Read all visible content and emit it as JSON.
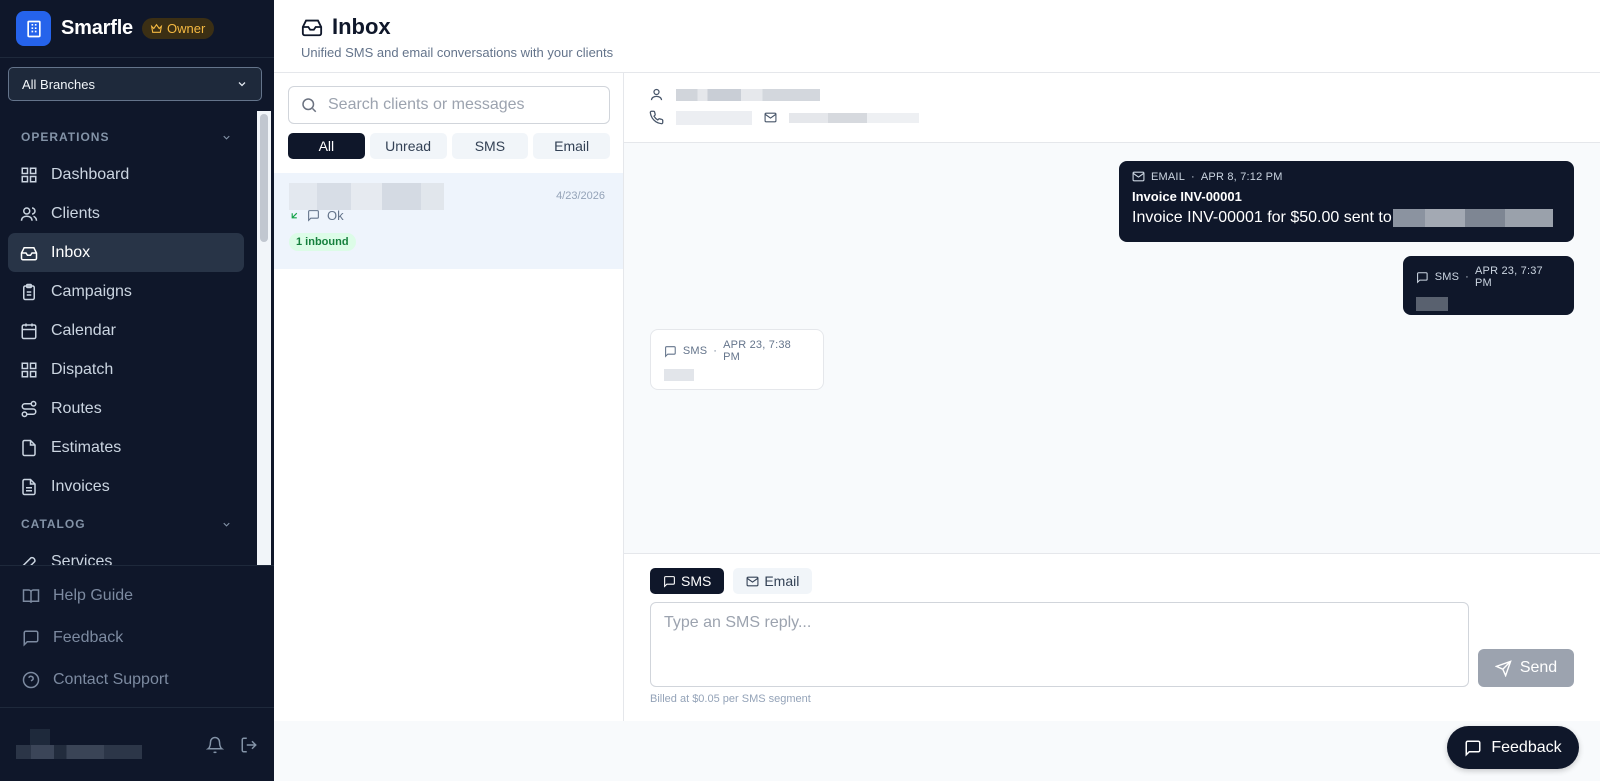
{
  "brand": {
    "name": "Smarfle",
    "role_badge": "Owner"
  },
  "branch_select": {
    "value": "All Branches"
  },
  "sidebar": {
    "sections": [
      {
        "label": "OPERATIONS",
        "items": [
          {
            "label": "Dashboard",
            "icon": "grid-icon"
          },
          {
            "label": "Clients",
            "icon": "users-icon"
          },
          {
            "label": "Inbox",
            "icon": "inbox-icon",
            "active": true
          },
          {
            "label": "Campaigns",
            "icon": "clipboard-icon"
          },
          {
            "label": "Calendar",
            "icon": "calendar-icon"
          },
          {
            "label": "Dispatch",
            "icon": "grid-icon"
          },
          {
            "label": "Routes",
            "icon": "route-icon"
          },
          {
            "label": "Estimates",
            "icon": "file-icon"
          },
          {
            "label": "Invoices",
            "icon": "file-text-icon"
          }
        ]
      },
      {
        "label": "CATALOG",
        "items": [
          {
            "label": "Services",
            "icon": "wrench-icon"
          }
        ]
      }
    ],
    "bottom_links": [
      {
        "label": "Help Guide",
        "icon": "book-icon"
      },
      {
        "label": "Feedback",
        "icon": "message-icon"
      },
      {
        "label": "Contact Support",
        "icon": "help-circle-icon"
      }
    ]
  },
  "header": {
    "title": "Inbox",
    "subtitle": "Unified SMS and email conversations with your clients"
  },
  "conversation_list": {
    "search_placeholder": "Search clients or messages",
    "filters": [
      "All",
      "Unread",
      "SMS",
      "Email"
    ],
    "active_filter": "All",
    "items": [
      {
        "date": "4/23/2026",
        "preview": "Ok",
        "badge": "1 inbound"
      }
    ]
  },
  "thread": {
    "messages": [
      {
        "direction": "out",
        "channel": "EMAIL",
        "time": "APR 8, 7:12 PM",
        "subject": "Invoice INV-00001",
        "body": "Invoice INV-00001 for $50.00 sent to"
      },
      {
        "direction": "out",
        "channel": "SMS",
        "time": "APR 23, 7:37 PM"
      },
      {
        "direction": "in",
        "channel": "SMS",
        "time": "APR 23, 7:38 PM"
      }
    ]
  },
  "composer": {
    "tabs": [
      "SMS",
      "Email"
    ],
    "active_tab": "SMS",
    "placeholder": "Type an SMS reply...",
    "billing_note": "Billed at $0.05 per SMS segment",
    "send_label": "Send"
  },
  "feedback_fab": {
    "label": "Feedback"
  },
  "colors": {
    "sidebar_bg": "#0f172a",
    "accent": "#2563eb",
    "owner_badge": "#f5b942",
    "inbound_badge": "#15803d"
  }
}
